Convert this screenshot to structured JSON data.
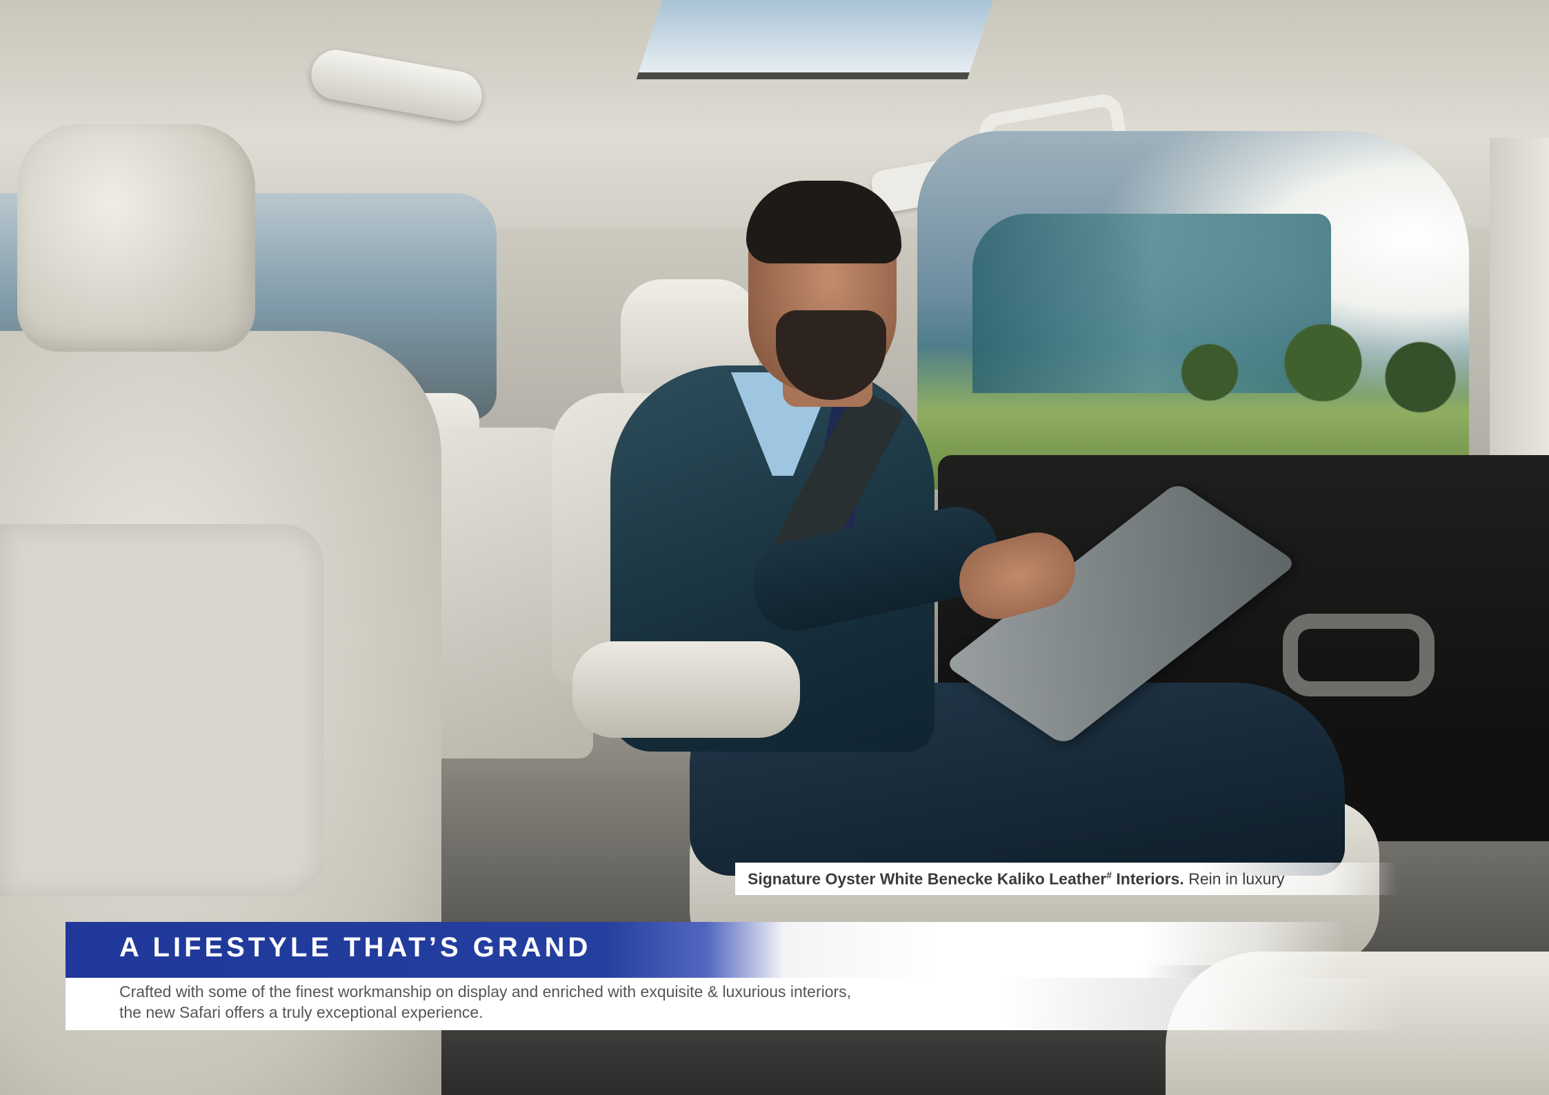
{
  "caption": {
    "bold": "Signature Oyster White Benecke Kaliko Leather",
    "sup": "#",
    "bold_tail": " Interiors.",
    "rest": " Rein in luxury"
  },
  "headline": "A LIFESTYLE THAT’S GRAND",
  "body": {
    "line1": "Crafted with some of the finest workmanship on display and enriched with exquisite & luxurious interiors,",
    "line2": "the new Safari offers a truly exceptional experience."
  },
  "colors": {
    "headline_bar": "#243f9f",
    "upholstery": "#e6e4dc",
    "body_text": "#555555"
  }
}
